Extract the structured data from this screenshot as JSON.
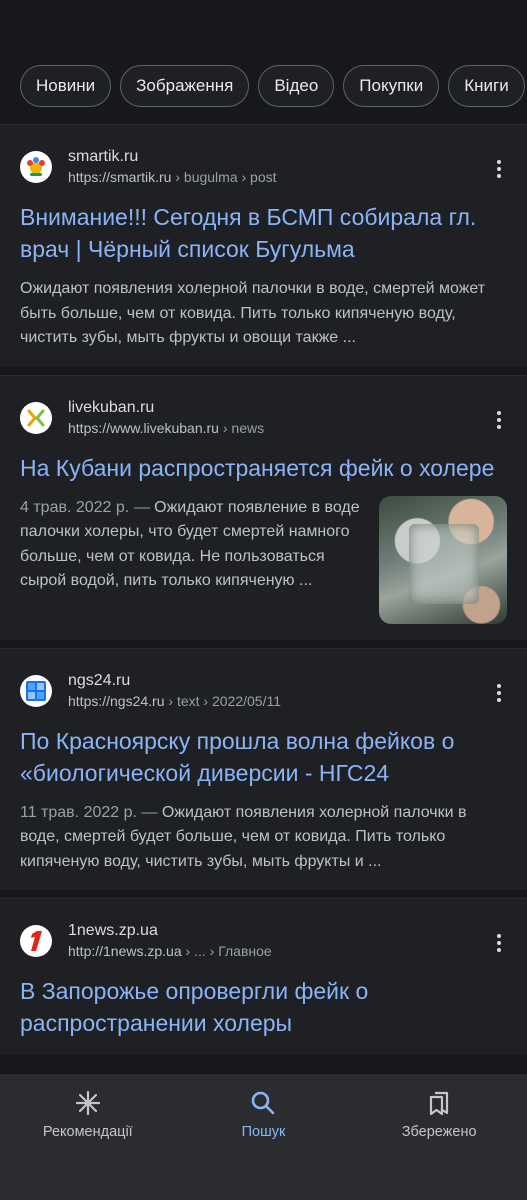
{
  "chips": [
    "Новини",
    "Зображення",
    "Відео",
    "Покупки",
    "Книги"
  ],
  "results": [
    {
      "site": "smartik.ru",
      "url_base": "https://smartik.ru",
      "url_path": " › bugulma › post",
      "title": "Внимание!!! Сегодня в БСМП собирала гл. врач | Чёрный список Бугульма",
      "date": "",
      "snippet": "Ожидают появления холерной палочки в воде, смертей может быть больше, чем от ковида. Пить только кипяченую воду, чистить зубы, мыть фрукты и овощи также ..."
    },
    {
      "site": "livekuban.ru",
      "url_base": "https://www.livekuban.ru",
      "url_path": " › news",
      "title": "На Кубани распространяется фейк о холере",
      "date": "4 трав. 2022 р. — ",
      "snippet": "Ожидают появление в воде палочки холеры, что будет смертей намного больше, чем от ковида. Не пользоваться сырой водой, пить только кипяченую ..."
    },
    {
      "site": "ngs24.ru",
      "url_base": "https://ngs24.ru",
      "url_path": " › text › 2022/05/11",
      "title": "По Красноярску прошла волна фейков о «биологической диверсии - НГС24",
      "date": "11 трав. 2022 р. — ",
      "snippet": "Ожидают появления холерной палочки в воде, смертей будет больше, чем от ковида. Пить только кипяченую воду, чистить зубы, мыть фрукты и ..."
    },
    {
      "site": "1news.zp.ua",
      "url_base": "http://1news.zp.ua",
      "url_path": " › ... › Главное",
      "title": "В Запорожье опровергли фейк о распространении холеры",
      "date": "",
      "snippet": ""
    }
  ],
  "nav": [
    {
      "label": "Рекомендації",
      "icon": "asterisk-icon"
    },
    {
      "label": "Пошук",
      "icon": "search-icon"
    },
    {
      "label": "Збережено",
      "icon": "bookmarks-icon"
    }
  ],
  "colors": {
    "accent": "#8ab4f8",
    "background": "#17181b",
    "card": "#1f2023"
  }
}
